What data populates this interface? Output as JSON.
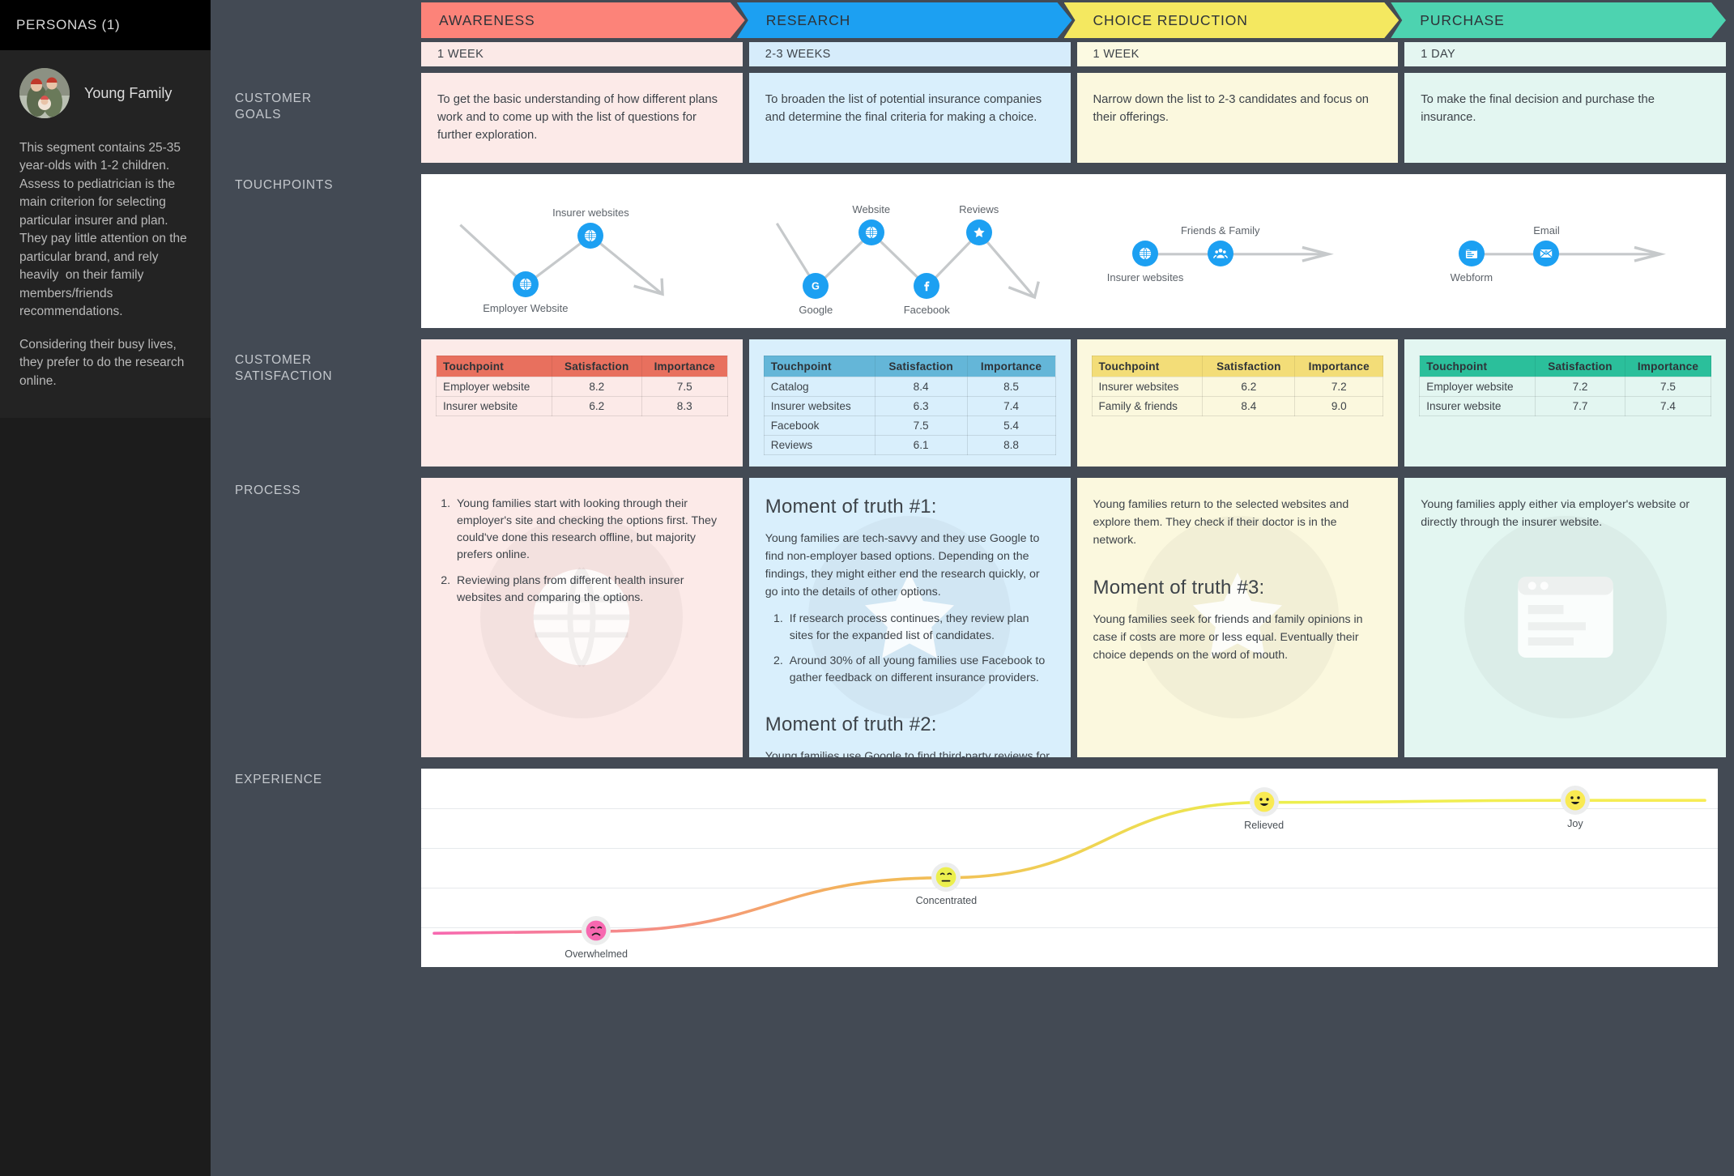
{
  "sidebar": {
    "header_title": "PERSONAS (1)",
    "persona": {
      "name": "Young Family",
      "avatar_icon": "family-photo-avatar",
      "description": "This segment contains 25-35 year-olds with 1-2 children. Assess to pediatrician is the main criterion for selecting particular insurer and plan. They pay little attention on the particular brand, and rely heavily  on their family members/friends recommendations.",
      "description2": "Considering their busy lives, they prefer to do the research online."
    }
  },
  "row_labels": {
    "goals": "CUSTOMER\nGOALS",
    "touchpoints": "TOUCHPOINTS",
    "satisfaction": "CUSTOMER\nSATISFACTION",
    "process": "PROCESS",
    "experience": "EXPERIENCE"
  },
  "stages": [
    {
      "name": "AWARENESS",
      "color": "#fc8379",
      "tint": "#fceae8",
      "header_color": "#fbe9e7",
      "duration": "1 WEEK",
      "goal": "To get the basic understanding of how different plans work and to come up with the list of questions for further exploration.",
      "table_header_color": "#e8705e",
      "touchpoints": [
        {
          "label": "Employer Website",
          "icon": "globe-icon",
          "label_pos": "below"
        },
        {
          "label": "Insurer websites",
          "icon": "globe-icon",
          "label_pos": "above"
        }
      ],
      "satisfaction_rows": [
        {
          "touchpoint": "Employer website",
          "satisfaction": "8.2",
          "importance": "7.5"
        },
        {
          "touchpoint": "Insurer website",
          "satisfaction": "6.2",
          "importance": "8.3"
        }
      ],
      "process_blocks": [
        {
          "type": "ordered_list",
          "items": [
            "Young families start with looking through their employer's site and checking the options first. They could've done this research offline, but majority prefers online.",
            "Reviewing plans from different health insurer websites and comparing the options."
          ]
        }
      ],
      "watermark_icon": "globe-icon"
    },
    {
      "name": "RESEARCH",
      "color": "#1ca0f2",
      "tint": "#d9effc",
      "header_color": "#d6ecfb",
      "duration": "2-3 WEEKS",
      "goal": "To broaden the list of potential insurance companies and determine the final criteria for making a choice.",
      "table_header_color": "#64b6d8",
      "touchpoints": [
        {
          "label": "Google",
          "icon": "google-icon",
          "label_pos": "below"
        },
        {
          "label": "Website",
          "icon": "globe-icon",
          "label_pos": "above"
        },
        {
          "label": "Facebook",
          "icon": "facebook-icon",
          "label_pos": "below"
        },
        {
          "label": "Reviews",
          "icon": "star-icon",
          "label_pos": "above"
        }
      ],
      "satisfaction_rows": [
        {
          "touchpoint": "Catalog",
          "satisfaction": "8.4",
          "importance": "8.5"
        },
        {
          "touchpoint": "Insurer websites",
          "satisfaction": "6.3",
          "importance": "7.4"
        },
        {
          "touchpoint": "Facebook",
          "satisfaction": "7.5",
          "importance": "5.4"
        },
        {
          "touchpoint": "Reviews",
          "satisfaction": "6.1",
          "importance": "8.8"
        }
      ],
      "process_blocks": [
        {
          "type": "heading",
          "text": "Moment of truth #1:"
        },
        {
          "type": "paragraph",
          "text": "Young families are tech-savvy and they use Google to find non-employer based options. Depending on the findings, they might either end the research quickly, or go into the details of other options."
        },
        {
          "type": "ordered_list_inner",
          "items": [
            "If research process continues, they review plan sites for the expanded list of candidates.",
            "Around 30% of all young families use Facebook to gather feedback on different insurance providers."
          ]
        },
        {
          "type": "gap"
        },
        {
          "type": "heading",
          "text": "Moment of truth #2:"
        },
        {
          "type": "paragraph",
          "text": "Young families use Google to find third-party reviews for the plans. While the cost is one of the top criteria, many are frustrated by the lack of other useful comparisons. They typically make their own spreadsheets and reduce the list to 2-3 candidates."
        }
      ],
      "watermark_icon": "star-icon"
    },
    {
      "name": "CHOICE REDUCTION",
      "color": "#f4e860",
      "tint": "#fbf8de",
      "header_color": "#fcfae2",
      "duration": "1 WEEK",
      "goal": "Narrow down the list to 2-3 candidates and focus on their offerings.",
      "table_header_color": "#f3dd78",
      "touchpoints": [
        {
          "label": "Insurer websites",
          "icon": "globe-icon",
          "label_pos": "below"
        },
        {
          "label": "Friends & Family",
          "icon": "people-icon",
          "label_pos": "above"
        }
      ],
      "satisfaction_rows": [
        {
          "touchpoint": "Insurer websites",
          "satisfaction": "6.2",
          "importance": "7.2"
        },
        {
          "touchpoint": "Family & friends",
          "satisfaction": "8.4",
          "importance": "9.0"
        }
      ],
      "process_blocks": [
        {
          "type": "paragraph",
          "text": "Young families return to the selected websites and explore them. They check if their doctor is in the network."
        },
        {
          "type": "gap"
        },
        {
          "type": "heading",
          "text": "Moment of truth #3:"
        },
        {
          "type": "paragraph",
          "text": "Young families seek for friends and family opinions in case if costs are more or less equal. Eventually their choice depends on the word of mouth."
        }
      ],
      "watermark_icon": "star-icon"
    },
    {
      "name": "PURCHASE",
      "color": "#4dd3b0",
      "tint": "#e3f6f1",
      "header_color": "#e4f6f1",
      "duration": "1 DAY",
      "goal": "To make the final decision and purchase the insurance.",
      "table_header_color": "#2bbf9b",
      "touchpoints": [
        {
          "label": "Webform",
          "icon": "webform-icon",
          "label_pos": "below"
        },
        {
          "label": "Email",
          "icon": "email-icon",
          "label_pos": "above"
        }
      ],
      "satisfaction_rows": [
        {
          "touchpoint": "Employer website",
          "satisfaction": "7.2",
          "importance": "7.5"
        },
        {
          "touchpoint": "Insurer website",
          "satisfaction": "7.7",
          "importance": "7.4"
        }
      ],
      "process_blocks": [
        {
          "type": "paragraph",
          "text": "Young families apply either via employer's website or directly through the insurer website."
        }
      ],
      "watermark_icon": "webform-icon"
    }
  ],
  "satisfaction_table": {
    "columns": [
      "Touchpoint",
      "Satisfaction",
      "Importance"
    ]
  },
  "chart_data": {
    "type": "line",
    "title": "EXPERIENCE",
    "xlabel": "",
    "ylabel": "",
    "grid": true,
    "points": [
      {
        "label": "Overwhelmed",
        "x": 13.5,
        "y": 0.18,
        "emoji": "sad-face",
        "color": "#f768b0"
      },
      {
        "label": "Concentrated",
        "x": 40.5,
        "y": 0.45,
        "emoji": "neutral-face",
        "color": "#ecef4e"
      },
      {
        "label": "Relieved",
        "x": 65.0,
        "y": 0.83,
        "emoji": "happy-face",
        "color": "#f9ea52"
      },
      {
        "label": "Joy",
        "x": 89.0,
        "y": 0.84,
        "emoji": "happy-face",
        "color": "#f9ea52"
      }
    ],
    "line_gradient": [
      "#f768b0",
      "#f3b45a",
      "#ecef4e",
      "#f7ec55"
    ],
    "ylim": [
      0,
      1
    ],
    "gridline_count": 5
  }
}
